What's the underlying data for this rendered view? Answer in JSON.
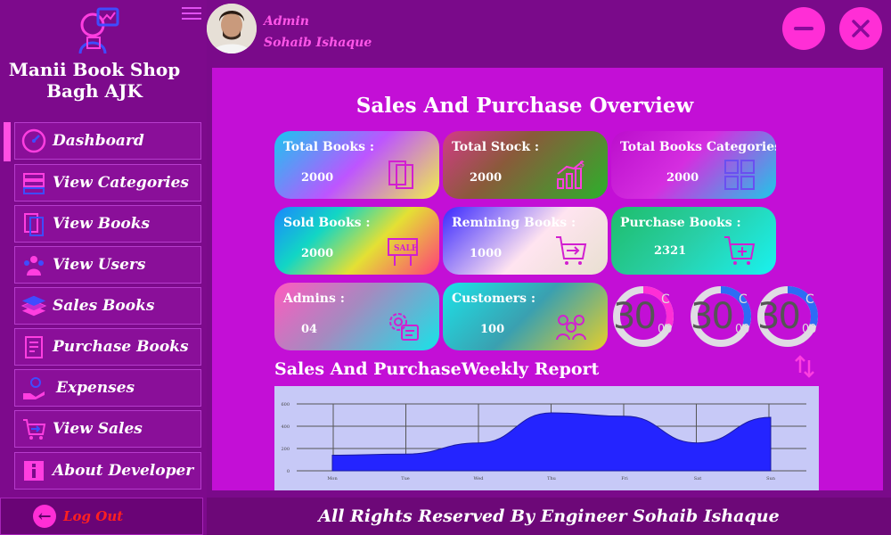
{
  "app": {
    "shop_name_line1": "Manii Book Shop",
    "shop_name_line2": "Bagh AJK"
  },
  "sidebar": {
    "items": [
      {
        "label": "Dashboard",
        "icon": "dashboard-gauge-icon"
      },
      {
        "label": "View Categories",
        "icon": "categories-icon"
      },
      {
        "label": "View Books",
        "icon": "books-icon"
      },
      {
        "label": "View Users",
        "icon": "users-icon"
      },
      {
        "label": "Sales Books",
        "icon": "book-stack-icon"
      },
      {
        "label": "Purchase Books",
        "icon": "receipt-icon"
      },
      {
        "label": "Expenses",
        "icon": "hand-money-icon"
      },
      {
        "label": "View Sales",
        "icon": "cart-arrow-icon"
      },
      {
        "label": "About Developer",
        "icon": "info-icon"
      }
    ],
    "logout_label": "Log Out"
  },
  "header": {
    "role": "Admin",
    "user_name": "Sohaib Ishaque"
  },
  "dashboard": {
    "title": "Sales And Purchase Overview",
    "cards": [
      {
        "label": "Total Books :",
        "value": "2000",
        "icon": "books-icon"
      },
      {
        "label": "Total Stock :",
        "value": "2000",
        "icon": "stock-chart-icon"
      },
      {
        "label": "Total Books Categories :",
        "value": "2000",
        "icon": "grid-icon"
      },
      {
        "label": "Sold Books :",
        "value": "2000",
        "icon": "sale-sign-icon"
      },
      {
        "label": "Remining Books :",
        "value": "1000",
        "icon": "cart-arrow-icon"
      },
      {
        "label": "Purchase Books :",
        "value": "2321",
        "icon": "cart-plus-icon"
      },
      {
        "label": "Admins :",
        "value": "04",
        "icon": "admin-settings-icon"
      },
      {
        "label": "Customers :",
        "value": "100",
        "icon": "customers-icon"
      }
    ],
    "rings": [
      {
        "value": "30",
        "top_text": "C",
        "bottom_text": "00",
        "color": "#ff2ed6",
        "fraction": 0.3
      },
      {
        "value": "30",
        "top_text": "C",
        "bottom_text": "00",
        "color": "#2d6cf5",
        "fraction": 0.3
      },
      {
        "value": "30",
        "top_text": "C",
        "bottom_text": "00",
        "color": "#2d6cf5",
        "fraction": 0.3
      }
    ],
    "report_title": "Sales And PurchaseWeekly Report"
  },
  "chart_data": {
    "type": "area",
    "x": [
      "Mon",
      "Tue",
      "Wed",
      "Thu",
      "Fri",
      "Sat",
      "Sun"
    ],
    "values": [
      140,
      150,
      250,
      520,
      490,
      250,
      480
    ],
    "y_ticks": [
      "0",
      "200",
      "400",
      "600"
    ],
    "ylim": [
      0,
      600
    ],
    "color": "#2424ff",
    "grid": true
  },
  "footer": {
    "text": "All Rights Reserved By Engineer Sohaib Ishaque"
  },
  "colors": {
    "background": "#7a0a8a",
    "accent": "#ff2ed6",
    "panel": "#c30fd6"
  }
}
